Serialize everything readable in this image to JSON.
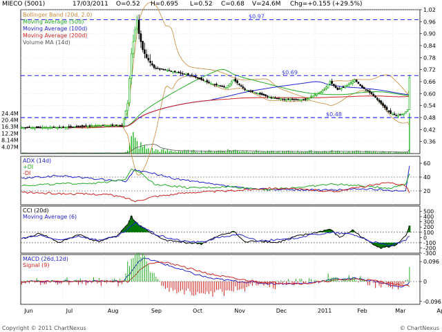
{
  "header": {
    "symbol": "MIECO (5001)",
    "date": "17/03/2011",
    "open": "O=0.52",
    "high": "H=0.695",
    "low": "L=0.52",
    "close": "C=0.68",
    "volume": "V=24.6M",
    "change": "Chg=+0.155 (+29.5%)"
  },
  "footer": {
    "copyright": "Copyright © 2011 ChartNexus",
    "watermark": "© ChartNexus"
  },
  "colors": {
    "bollinger": "#c8883a",
    "ma50": "#22aa22",
    "ma100": "#2222cc",
    "ma200": "#cc2222",
    "volma": "#555555",
    "candle_up": "#00aa00",
    "candle_down": "#000000",
    "dashed": "#3333ee",
    "adx": "#2222cc",
    "pdi": "#22aa22",
    "mdi": "#cc2222",
    "cci": "#000000",
    "cci_ma": "#2222cc",
    "cci_fill": "#007700",
    "macd": "#2222cc",
    "signal": "#cc2222"
  },
  "chart_data": [
    {
      "panel": "price",
      "type": "candlestick",
      "legend": [
        "Bollinger Band (20d, 2.0)",
        "Moving Average (50d)",
        "Moving Average (100d)",
        "Moving Average (200d)",
        "Volume MA (14d)"
      ],
      "x_months": [
        "Jun",
        "Jul",
        "Aug",
        "Sep",
        "Oct",
        "Nov",
        "Dec",
        "2011",
        "Feb",
        "Mar",
        "Apr"
      ],
      "y_ticks": [
        "1.02",
        "0.96",
        "0.90",
        "0.84",
        "0.78",
        "0.72",
        "0.66",
        "0.60",
        "0.54",
        "0.48",
        "0.42",
        "0.36"
      ],
      "ylim": [
        0.3,
        1.02
      ],
      "volume_ticks": [
        "24.4M",
        "20.4M",
        "16.3M",
        "12.2M",
        "8.14M",
        "4.07M"
      ],
      "annotations": [
        {
          "label": "$0.97",
          "value": 0.97
        },
        {
          "label": "$0.69",
          "value": 0.69
        },
        {
          "label": "$0.48",
          "value": 0.48
        }
      ],
      "price_anchors": [
        [
          0,
          0.43
        ],
        [
          20,
          0.43
        ],
        [
          40,
          0.44
        ],
        [
          53,
          0.44
        ],
        [
          56,
          0.55
        ],
        [
          58,
          0.8
        ],
        [
          60,
          0.92
        ],
        [
          61,
          0.97
        ],
        [
          62,
          0.9
        ],
        [
          64,
          0.82
        ],
        [
          66,
          0.78
        ],
        [
          70,
          0.73
        ],
        [
          80,
          0.71
        ],
        [
          90,
          0.69
        ],
        [
          100,
          0.65
        ],
        [
          108,
          0.63
        ],
        [
          112,
          0.67
        ],
        [
          118,
          0.62
        ],
        [
          125,
          0.6
        ],
        [
          132,
          0.58
        ],
        [
          140,
          0.57
        ],
        [
          150,
          0.57
        ],
        [
          160,
          0.62
        ],
        [
          163,
          0.66
        ],
        [
          167,
          0.62
        ],
        [
          172,
          0.64
        ],
        [
          176,
          0.67
        ],
        [
          180,
          0.63
        ],
        [
          185,
          0.6
        ],
        [
          190,
          0.55
        ],
        [
          195,
          0.5
        ],
        [
          198,
          0.49
        ],
        [
          202,
          0.5
        ],
        [
          204,
          0.52
        ],
        [
          205,
          0.68
        ]
      ],
      "volume_anchors": [
        [
          0,
          0.35
        ],
        [
          53,
          0.35
        ],
        [
          56,
          2.5
        ],
        [
          58,
          8.5
        ],
        [
          59,
          9.8
        ],
        [
          60,
          7.5
        ],
        [
          61,
          6.2
        ],
        [
          62,
          5.5
        ],
        [
          64,
          4.1
        ],
        [
          66,
          3.2
        ],
        [
          70,
          2.2
        ],
        [
          80,
          1.5
        ],
        [
          100,
          1.4
        ],
        [
          110,
          2.1
        ],
        [
          130,
          1.1
        ],
        [
          160,
          1.4
        ],
        [
          180,
          1.2
        ],
        [
          200,
          0.8
        ],
        [
          204,
          0.6
        ],
        [
          205,
          24.6
        ]
      ]
    },
    {
      "panel": "adx",
      "type": "line",
      "legend": [
        "ADX (14d)",
        "+DI",
        "-DI"
      ],
      "y_ticks": [
        "60",
        "40",
        "20"
      ],
      "ylim": [
        0,
        70
      ],
      "reference_lines": [
        40,
        20
      ],
      "series": [
        {
          "name": "ADX (14d)",
          "anchors": [
            [
              0,
              38
            ],
            [
              20,
              42
            ],
            [
              45,
              36
            ],
            [
              55,
              34
            ],
            [
              60,
              50
            ],
            [
              70,
              45
            ],
            [
              80,
              38
            ],
            [
              100,
              30
            ],
            [
              120,
              23
            ],
            [
              140,
              22
            ],
            [
              160,
              21
            ],
            [
              180,
              23
            ],
            [
              195,
              21
            ],
            [
              203,
              20
            ],
            [
              205,
              55
            ]
          ]
        },
        {
          "name": "+DI",
          "anchors": [
            [
              0,
              28
            ],
            [
              20,
              30
            ],
            [
              45,
              32
            ],
            [
              55,
              38
            ],
            [
              58,
              52
            ],
            [
              62,
              48
            ],
            [
              70,
              30
            ],
            [
              90,
              24
            ],
            [
              110,
              26
            ],
            [
              130,
              22
            ],
            [
              150,
              26
            ],
            [
              165,
              30
            ],
            [
              180,
              27
            ],
            [
              195,
              24
            ],
            [
              203,
              30
            ],
            [
              205,
              46
            ]
          ]
        },
        {
          "name": "-DI",
          "anchors": [
            [
              0,
              18
            ],
            [
              20,
              16
            ],
            [
              45,
              15
            ],
            [
              55,
              10
            ],
            [
              60,
              5
            ],
            [
              70,
              12
            ],
            [
              90,
              18
            ],
            [
              110,
              20
            ],
            [
              130,
              24
            ],
            [
              150,
              22
            ],
            [
              165,
              19
            ],
            [
              180,
              26
            ],
            [
              195,
              32
            ],
            [
              203,
              28
            ],
            [
              205,
              18
            ]
          ]
        }
      ]
    },
    {
      "panel": "cci",
      "type": "line",
      "legend": [
        "CCI (20d)",
        "Moving Average (6)"
      ],
      "y_ticks": [
        "500",
        "400",
        "300",
        "200",
        "100",
        "0",
        "-100",
        "-200",
        "-300"
      ],
      "ylim": [
        -300,
        600
      ],
      "reference_lines": [
        100,
        -100
      ],
      "series": [
        {
          "name": "CCI (20d)",
          "anchors": [
            [
              0,
              -30
            ],
            [
              10,
              80
            ],
            [
              20,
              -100
            ],
            [
              30,
              60
            ],
            [
              40,
              -80
            ],
            [
              50,
              20
            ],
            [
              56,
              250
            ],
            [
              58,
              400
            ],
            [
              60,
              300
            ],
            [
              63,
              220
            ],
            [
              68,
              100
            ],
            [
              75,
              -50
            ],
            [
              85,
              -90
            ],
            [
              95,
              -120
            ],
            [
              105,
              40
            ],
            [
              112,
              120
            ],
            [
              118,
              -90
            ],
            [
              125,
              -60
            ],
            [
              135,
              -100
            ],
            [
              145,
              20
            ],
            [
              155,
              90
            ],
            [
              163,
              160
            ],
            [
              168,
              0
            ],
            [
              175,
              140
            ],
            [
              182,
              -50
            ],
            [
              190,
              -200
            ],
            [
              197,
              -160
            ],
            [
              203,
              20
            ],
            [
              205,
              210
            ]
          ]
        },
        {
          "name": "Moving Average (6)",
          "anchors": [
            [
              0,
              -20
            ],
            [
              10,
              40
            ],
            [
              20,
              -60
            ],
            [
              30,
              30
            ],
            [
              40,
              -50
            ],
            [
              50,
              10
            ],
            [
              56,
              150
            ],
            [
              60,
              280
            ],
            [
              65,
              180
            ],
            [
              72,
              40
            ],
            [
              85,
              -70
            ],
            [
              95,
              -90
            ],
            [
              105,
              10
            ],
            [
              115,
              50
            ],
            [
              125,
              -60
            ],
            [
              140,
              -40
            ],
            [
              155,
              60
            ],
            [
              165,
              90
            ],
            [
              175,
              60
            ],
            [
              185,
              -80
            ],
            [
              195,
              -160
            ],
            [
              203,
              -60
            ],
            [
              205,
              40
            ]
          ]
        }
      ]
    },
    {
      "panel": "macd",
      "type": "line",
      "legend": [
        "MACD (26d,12d)",
        "Signal (9)"
      ],
      "y_ticks": [
        "0.096",
        "0",
        "-0.096"
      ],
      "ylim": [
        -0.11,
        0.13
      ],
      "series": [
        {
          "name": "MACD (26d,12d)",
          "anchors": [
            [
              0,
              0.0
            ],
            [
              40,
              0.002
            ],
            [
              54,
              0.0
            ],
            [
              58,
              0.05
            ],
            [
              62,
              0.1
            ],
            [
              65,
              0.112
            ],
            [
              70,
              0.1
            ],
            [
              80,
              0.07
            ],
            [
              90,
              0.04
            ],
            [
              100,
              0.015
            ],
            [
              115,
              0.0
            ],
            [
              130,
              -0.01
            ],
            [
              150,
              -0.01
            ],
            [
              165,
              0.012
            ],
            [
              178,
              0.015
            ],
            [
              190,
              -0.005
            ],
            [
              198,
              -0.025
            ],
            [
              203,
              -0.02
            ],
            [
              205,
              -0.005
            ]
          ]
        },
        {
          "name": "Signal (9)",
          "anchors": [
            [
              0,
              0.0
            ],
            [
              40,
              0.002
            ],
            [
              56,
              0.0
            ],
            [
              60,
              0.03
            ],
            [
              64,
              0.07
            ],
            [
              68,
              0.09
            ],
            [
              72,
              0.095
            ],
            [
              80,
              0.085
            ],
            [
              90,
              0.06
            ],
            [
              100,
              0.035
            ],
            [
              115,
              0.01
            ],
            [
              130,
              -0.005
            ],
            [
              150,
              -0.01
            ],
            [
              165,
              0.005
            ],
            [
              178,
              0.012
            ],
            [
              190,
              0.0
            ],
            [
              198,
              -0.015
            ],
            [
              205,
              -0.02
            ]
          ]
        }
      ]
    }
  ]
}
